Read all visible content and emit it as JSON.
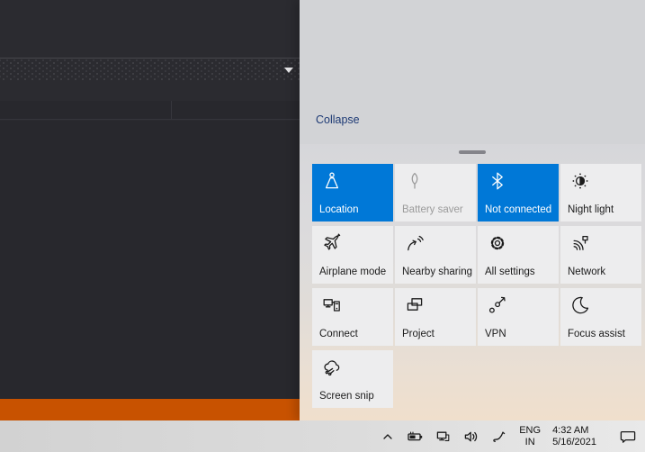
{
  "action_center": {
    "collapse_label": "Collapse",
    "accent_color": "#0078d7",
    "tiles": [
      {
        "label": "Location",
        "icon": "location-icon",
        "state": "active"
      },
      {
        "label": "Battery saver",
        "icon": "battery-saver-icon",
        "state": "disabled"
      },
      {
        "label": "Not connected",
        "icon": "bluetooth-icon",
        "state": "active"
      },
      {
        "label": "Night light",
        "icon": "night-light-icon",
        "state": "normal"
      },
      {
        "label": "Airplane mode",
        "icon": "airplane-icon",
        "state": "normal"
      },
      {
        "label": "Nearby sharing",
        "icon": "nearby-sharing-icon",
        "state": "normal"
      },
      {
        "label": "All settings",
        "icon": "settings-gear-icon",
        "state": "normal"
      },
      {
        "label": "Network",
        "icon": "network-icon",
        "state": "normal"
      },
      {
        "label": "Connect",
        "icon": "connect-icon",
        "state": "normal"
      },
      {
        "label": "Project",
        "icon": "project-icon",
        "state": "normal"
      },
      {
        "label": "VPN",
        "icon": "vpn-icon",
        "state": "normal"
      },
      {
        "label": "Focus assist",
        "icon": "focus-assist-icon",
        "state": "normal"
      },
      {
        "label": "Screen snip",
        "icon": "screen-snip-icon",
        "state": "normal"
      }
    ]
  },
  "app_window": {
    "statusbar_color": "#c85200"
  },
  "taskbar": {
    "language": {
      "line1": "ENG",
      "line2": "IN"
    },
    "clock": {
      "time": "4:32 AM",
      "date": "5/16/2021"
    }
  }
}
